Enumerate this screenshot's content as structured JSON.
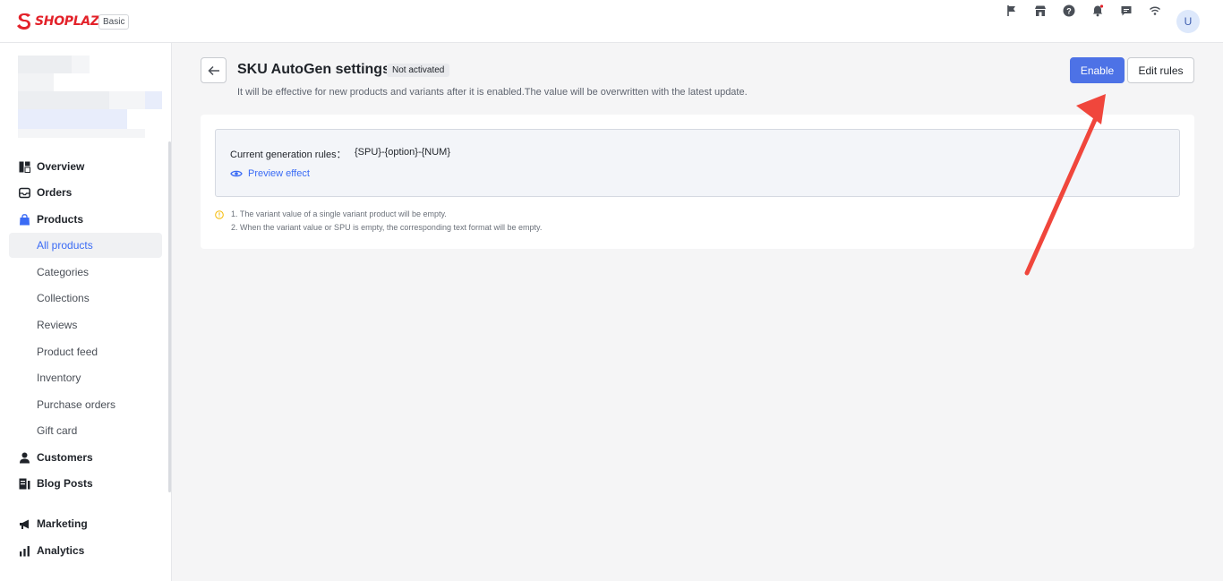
{
  "brand": {
    "logo_text": "SHOPLAZZA",
    "plan": "Basic",
    "color": "#e3222a"
  },
  "topbar": {
    "icons": [
      "flag-icon",
      "store-icon",
      "help-icon",
      "bell-icon",
      "message-icon",
      "wifi-icon"
    ],
    "avatar_initial": "U"
  },
  "sidebar": {
    "items": [
      {
        "label": "Overview",
        "icon": "dashboard-icon",
        "level": "main"
      },
      {
        "label": "Orders",
        "icon": "inbox-icon",
        "level": "main"
      },
      {
        "label": "Products",
        "icon": "bag-icon",
        "level": "main"
      },
      {
        "label": "All products",
        "level": "sub",
        "active": true
      },
      {
        "label": "Categories",
        "level": "sub"
      },
      {
        "label": "Collections",
        "level": "sub"
      },
      {
        "label": "Reviews",
        "level": "sub"
      },
      {
        "label": "Product feed",
        "level": "sub"
      },
      {
        "label": "Inventory",
        "level": "sub"
      },
      {
        "label": "Purchase orders",
        "level": "sub"
      },
      {
        "label": "Gift card",
        "level": "sub"
      },
      {
        "label": "Customers",
        "icon": "person-icon",
        "level": "main"
      },
      {
        "label": "Blog Posts",
        "icon": "blog-icon",
        "level": "main"
      },
      {
        "label": "Marketing",
        "icon": "megaphone-icon",
        "level": "main"
      },
      {
        "label": "Analytics",
        "icon": "bar-chart-icon",
        "level": "main"
      }
    ]
  },
  "header": {
    "title": "SKU AutoGen settings",
    "status": "Not activated",
    "subtitle": "It will be effective for new products and variants after it is enabled.The value will be overwritten with the latest update.",
    "enable_label": "Enable",
    "edit_label": "Edit rules"
  },
  "rules": {
    "label": "Current generation rules：",
    "value": "{SPU}-{option}-{NUM}",
    "preview_label": "Preview effect"
  },
  "notes": [
    "1. The variant value of a single variant product will be empty.",
    "2. When the variant value or SPU is empty, the corresponding text format will be empty."
  ],
  "colors": {
    "accent": "#3a6bf5",
    "primary_button": "#4d72e6",
    "annotation_arrow": "#f0463c",
    "warning": "#f5b900"
  }
}
